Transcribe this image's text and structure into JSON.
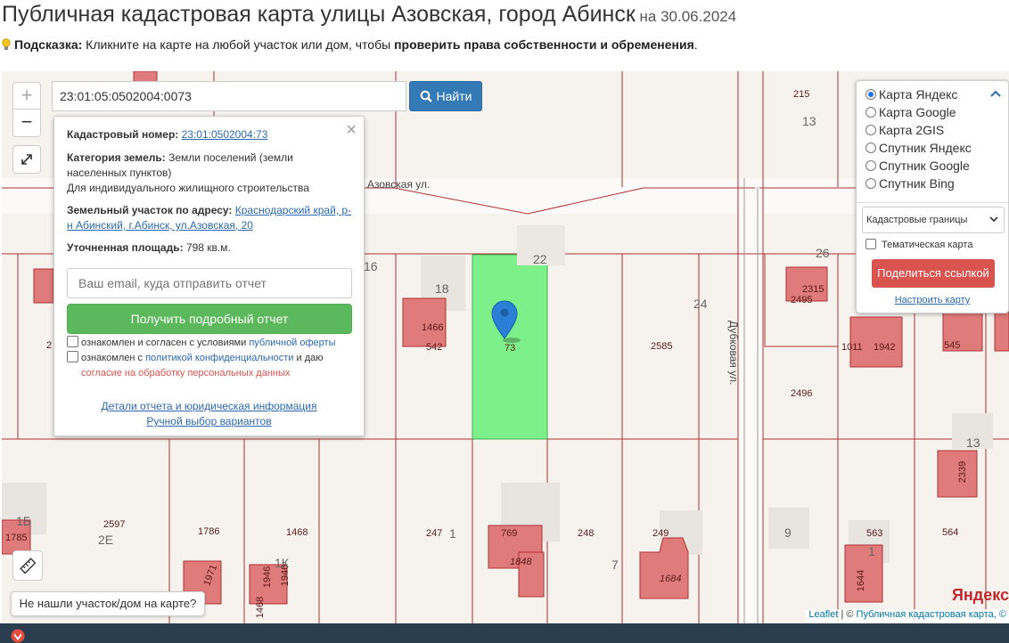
{
  "page": {
    "title": "Публичная кадастровая карта улицы Азовская, город Абинск",
    "date_prefix": " на ",
    "date": "30.06.2024"
  },
  "hint": {
    "label": "Подсказка:",
    "text_before": " Кликните на карте на любой участок или дом, чтобы ",
    "text_bold": "проверить права собственности и обременения",
    "text_after": "."
  },
  "search": {
    "value": "23:01:05:0502004:0073",
    "button_label": "Найти"
  },
  "zoom": {
    "in": "+",
    "out": "−"
  },
  "popup": {
    "cadastral_label": "Кадастровый номер:",
    "cadastral_value": "23:01:0502004:73",
    "category_label": "Категория земель:",
    "category_value": "Земли поселений (земли населенных пунктов)",
    "usage": "Для индивидуального жилищного строительства",
    "address_label": "Земельный участок по адресу:",
    "address_value": "Краснодарский край, р-н Абинский, г.Абинск, ул.Азовская, 20",
    "area_label": "Уточненная площадь:",
    "area_value": "798 кв.м.",
    "email_placeholder": "Ваш email, куда отправить отчет",
    "get_report": "Получить подробный отчет",
    "agree1_text": "ознакомлен и согласен с условиями ",
    "agree1_link": "публичной оферты",
    "agree2_text": "ознакомлен с ",
    "agree2_link": "политикой конфиденциальности",
    "agree2_mid": " и даю",
    "agree2_red": "согласие на обработку персональных данных",
    "details_link": "Детали отчета и юридическая информация",
    "manual_link": "Ручной выбор вариантов",
    "close": "×"
  },
  "layers": {
    "options": [
      "Карта Яндекс",
      "Карта Google",
      "Карта 2GIS",
      "Спутник Яндекс",
      "Спутник Google",
      "Спутник Bing"
    ],
    "selected_index": 0,
    "overlay_select": "Кадастровые границы",
    "thematic": "Тематическая карта",
    "share_button": "Поделиться ссылкой",
    "configure_link": "Настроить карту"
  },
  "map": {
    "streets": {
      "azovskaya": "Азовская ул.",
      "dubkovaya": "Дубковая ул."
    },
    "parcel_labels": [
      "1466",
      "542",
      "73",
      "2585",
      "2315",
      "2495",
      "1011",
      "1942",
      "545",
      "2496",
      "2339",
      "2597",
      "1785",
      "1786",
      "1468",
      "1971",
      "1946",
      "1946",
      "1468",
      "247",
      "769",
      "1848",
      "248",
      "249",
      "1684",
      "563",
      "1644",
      "564",
      "215",
      "2"
    ],
    "block_labels": [
      "13",
      "16",
      "18",
      "22",
      "24",
      "26",
      "13",
      "1Б",
      "2Е",
      "1К",
      "1",
      "7",
      "9",
      "1"
    ],
    "highlight_color": "#7df08a",
    "building_color": "#e07b7b"
  },
  "not_found": "Не нашли участок/дом на карте?",
  "attribution": {
    "leaflet": "Leaflet",
    "separator": " | © ",
    "source": "Публичная кадастровая карта, ©"
  },
  "yandex_mark": "Яндекс"
}
